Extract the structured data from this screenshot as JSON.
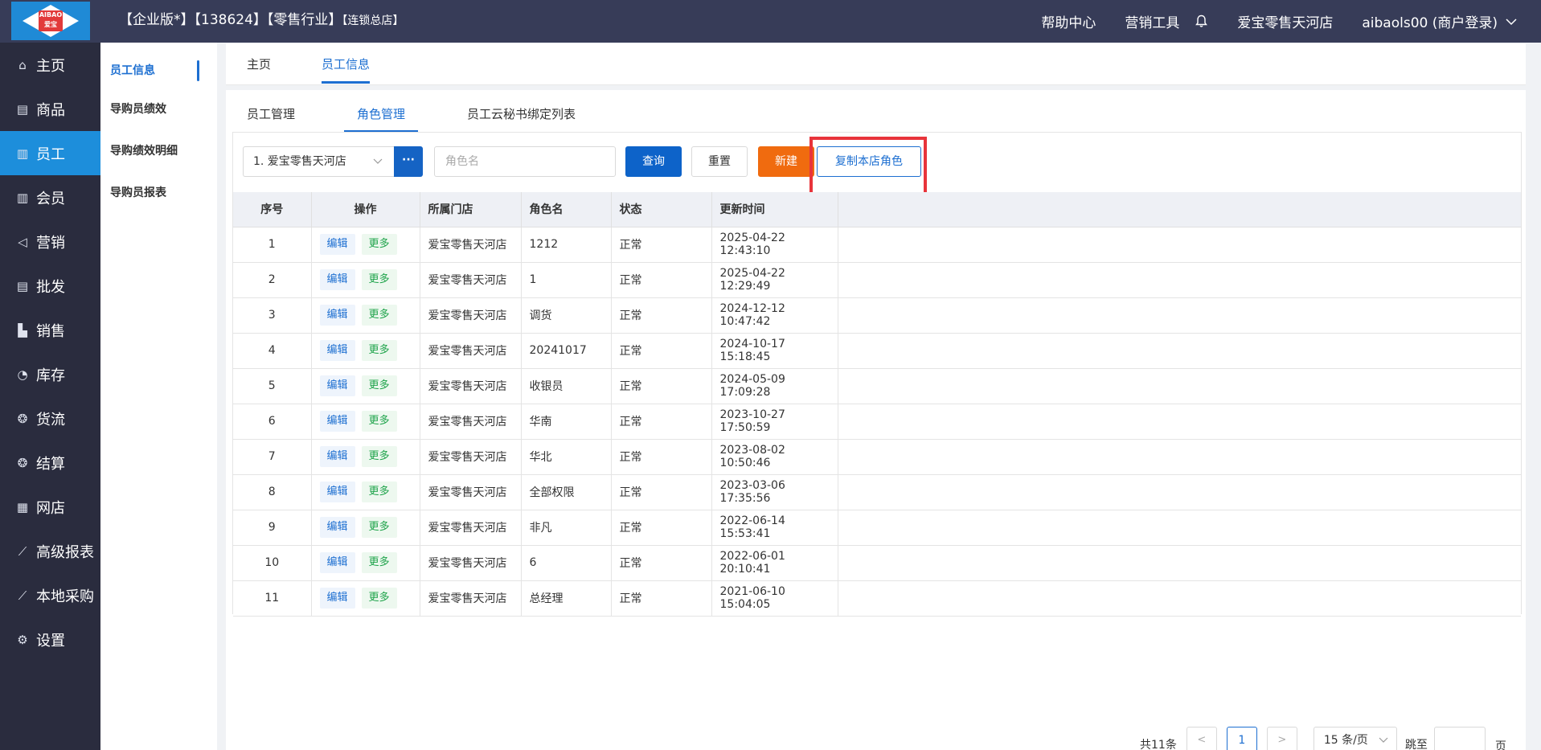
{
  "logo": {
    "top_text": "AIBAO",
    "bottom_text": "爱宝"
  },
  "header": {
    "title_main": "【企业版*】【138624】【零售行业】",
    "title_small": "【连锁总店】",
    "help": "帮助中心",
    "marketing": "营销工具",
    "store": "爱宝零售天河店",
    "user": "aibaols00 (商户登录)"
  },
  "nav": [
    {
      "label": "主页",
      "icon": "⌂"
    },
    {
      "label": "商品",
      "icon": "▤"
    },
    {
      "label": "员工",
      "icon": "▥"
    },
    {
      "label": "会员",
      "icon": "▥"
    },
    {
      "label": "营销",
      "icon": "◁"
    },
    {
      "label": "批发",
      "icon": "▤"
    },
    {
      "label": "销售",
      "icon": "▙"
    },
    {
      "label": "库存",
      "icon": "◔"
    },
    {
      "label": "货流",
      "icon": "❂"
    },
    {
      "label": "结算",
      "icon": "❂"
    },
    {
      "label": "网店",
      "icon": "▦"
    },
    {
      "label": "高级报表",
      "icon": "⟋"
    },
    {
      "label": "本地采购",
      "icon": "⟋"
    },
    {
      "label": "设置",
      "icon": "⚙"
    }
  ],
  "subnav": [
    "员工信息",
    "导购员绩效",
    "导购绩效明细",
    "导购员报表"
  ],
  "page_tabs": [
    "主页",
    "员工信息"
  ],
  "inner_tabs": [
    "员工管理",
    "角色管理",
    "员工云秘书绑定列表"
  ],
  "toolbar": {
    "store_select": "1. 爱宝零售天河店",
    "dots": "···",
    "role_placeholder": "角色名",
    "query": "查询",
    "reset": "重置",
    "new": "新建",
    "copy": "复制本店角色"
  },
  "table": {
    "headers": [
      "序号",
      "操作",
      "所属门店",
      "角色名",
      "状态",
      "更新时间"
    ],
    "edit_label": "编辑",
    "more_label": "更多",
    "rows": [
      {
        "no": "1",
        "store": "爱宝零售天河店",
        "role": "1212",
        "status": "正常",
        "time": "2025-04-22 12:43:10"
      },
      {
        "no": "2",
        "store": "爱宝零售天河店",
        "role": "1",
        "status": "正常",
        "time": "2025-04-22 12:29:49"
      },
      {
        "no": "3",
        "store": "爱宝零售天河店",
        "role": "调货",
        "status": "正常",
        "time": "2024-12-12 10:47:42"
      },
      {
        "no": "4",
        "store": "爱宝零售天河店",
        "role": "20241017",
        "status": "正常",
        "time": "2024-10-17 15:18:45"
      },
      {
        "no": "5",
        "store": "爱宝零售天河店",
        "role": "收银员",
        "status": "正常",
        "time": "2024-05-09 17:09:28"
      },
      {
        "no": "6",
        "store": "爱宝零售天河店",
        "role": "华南",
        "status": "正常",
        "time": "2023-10-27 17:50:59"
      },
      {
        "no": "7",
        "store": "爱宝零售天河店",
        "role": "华北",
        "status": "正常",
        "time": "2023-08-02 10:50:46"
      },
      {
        "no": "8",
        "store": "爱宝零售天河店",
        "role": "全部权限",
        "status": "正常",
        "time": "2023-03-06 17:35:56"
      },
      {
        "no": "9",
        "store": "爱宝零售天河店",
        "role": "非凡",
        "status": "正常",
        "time": "2022-06-14 15:53:41"
      },
      {
        "no": "10",
        "store": "爱宝零售天河店",
        "role": "6",
        "status": "正常",
        "time": "2022-06-01 20:10:41"
      },
      {
        "no": "11",
        "store": "爱宝零售天河店",
        "role": "总经理",
        "status": "正常",
        "time": "2021-06-10 15:04:05"
      }
    ]
  },
  "pager": {
    "total": "共11条",
    "prev": "<",
    "current": "1",
    "next": ">",
    "page_size": "15 条/页",
    "jump_label": "跳至",
    "unit": "页"
  },
  "colors": {
    "accent": "#1d6fd1",
    "primary_button": "#0d63c9",
    "new_button": "#f06b0f",
    "highlight_box": "#e8343b",
    "nav_active": "#1d8edb"
  }
}
